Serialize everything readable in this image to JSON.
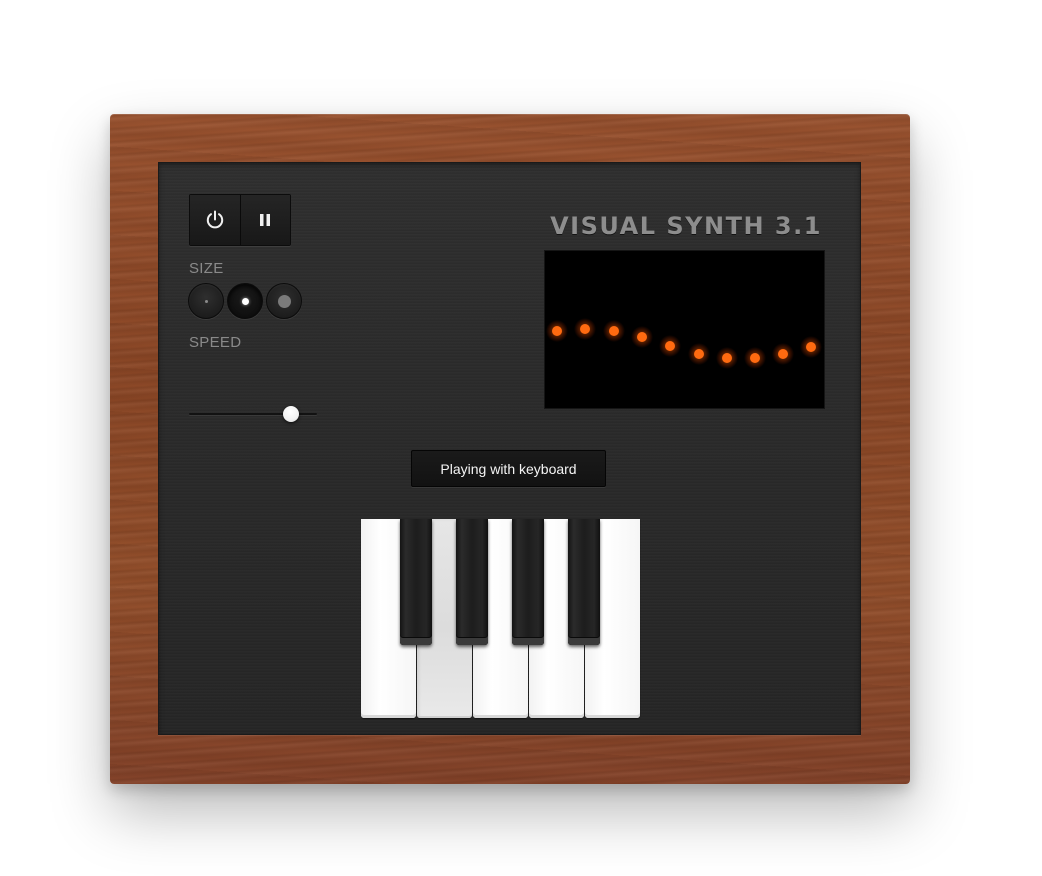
{
  "app": {
    "title": "VISUAL SYNTH 3.1"
  },
  "controls": {
    "power_icon": "power-icon",
    "pause_icon": "pause-icon",
    "size_label": "SIZE",
    "size_options": [
      "small",
      "medium",
      "large"
    ],
    "size_selected": "medium",
    "speed_label": "SPEED",
    "speed_value": 0.84
  },
  "display": {
    "dot_color": "#ff6a10",
    "dot_count": 10
  },
  "mode_button": {
    "label": "Playing with keyboard"
  },
  "keyboard": {
    "white_keys": 5,
    "black_keys": 4,
    "pressed_white_key_index": 1
  },
  "colors": {
    "wood": "#8c4827",
    "panel": "#2a2a2a",
    "accent": "#ff6a10"
  }
}
